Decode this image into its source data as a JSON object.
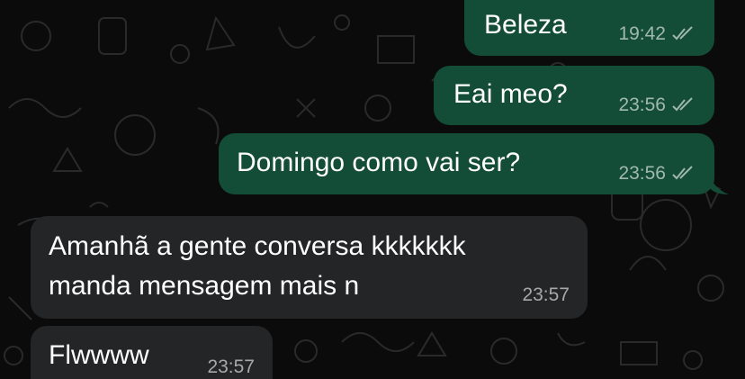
{
  "messages": [
    {
      "text": "Beleza",
      "time": "19:42",
      "direction": "outgoing",
      "status_icon": "double-check-icon"
    },
    {
      "text": "Eai meo?",
      "time": "23:56",
      "direction": "outgoing",
      "status_icon": "double-check-icon"
    },
    {
      "text": "Domingo como vai ser?",
      "time": "23:56",
      "direction": "outgoing",
      "status_icon": "double-check-icon"
    },
    {
      "lines": [
        "Amanhã a gente conversa kkkkkkk",
        "manda mensagem mais n"
      ],
      "time": "23:57",
      "direction": "incoming"
    },
    {
      "text": "Flwwww",
      "time": "23:57",
      "direction": "incoming"
    }
  ],
  "colors": {
    "background": "#0b0b0b",
    "outgoing_bubble": "#134d37",
    "incoming_bubble": "#232527",
    "meta_text": "#a6a6a6"
  }
}
